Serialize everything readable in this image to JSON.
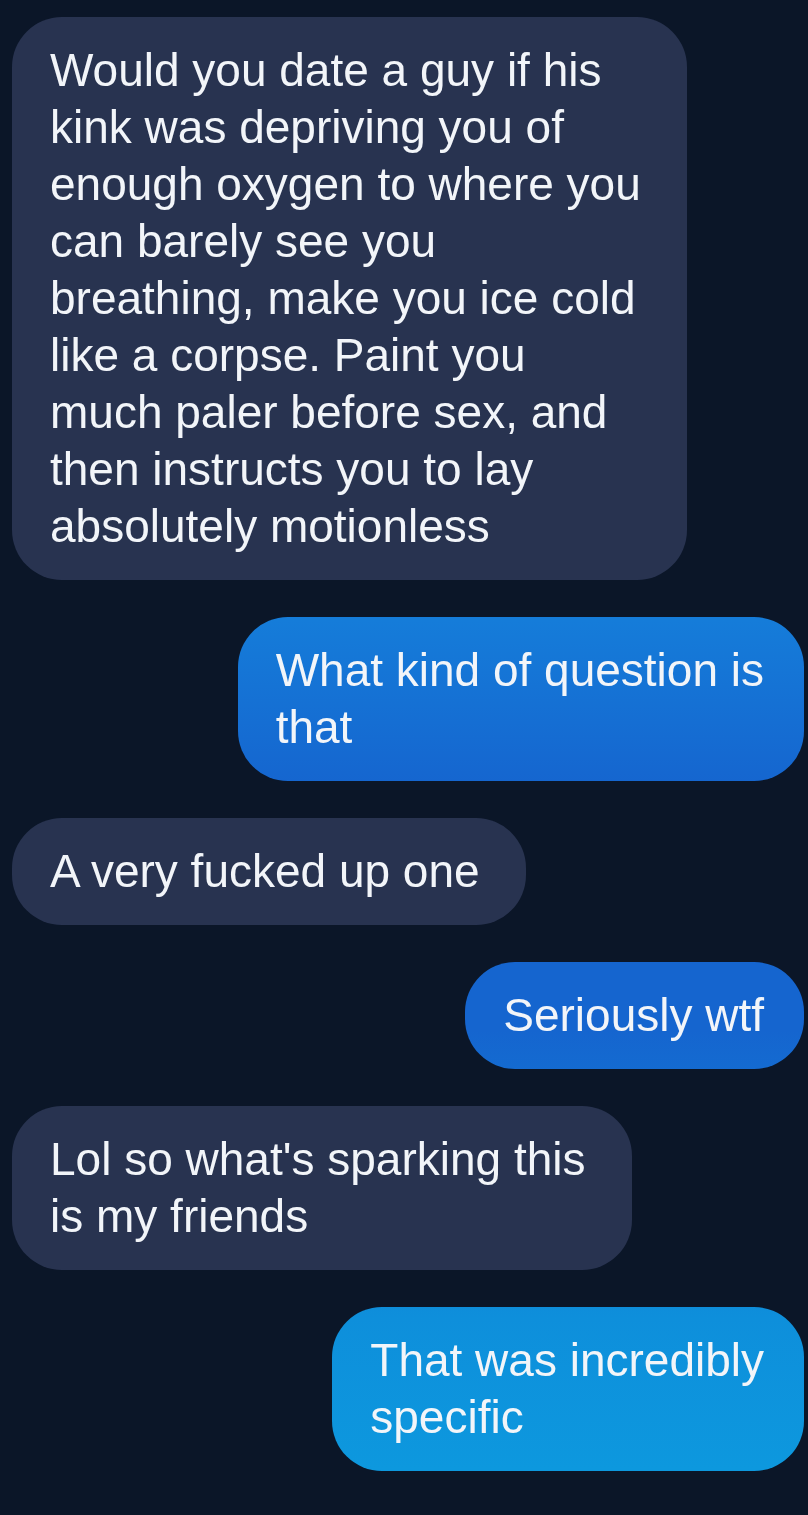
{
  "messages": [
    {
      "kind": "received",
      "lines": [
        "Would you date a guy if his",
        "kink was depriving you of",
        "enough oxygen to where you",
        "can barely see you",
        "breathing, make you ice cold",
        "like a corpse. Paint you",
        "much paler before sex, and",
        "then instructs you to lay",
        "absolutely motionless"
      ]
    },
    {
      "kind": "sent",
      "lines": [
        "What kind of question is",
        "that"
      ]
    },
    {
      "kind": "received",
      "lines": [
        "A very fucked up one"
      ]
    },
    {
      "kind": "sent",
      "lines": [
        "Seriously wtf"
      ]
    },
    {
      "kind": "received",
      "lines": [
        "Lol so what's sparking this",
        "is my friends"
      ]
    },
    {
      "kind": "sent",
      "lines": [
        "That was incredibly",
        "specific"
      ]
    }
  ]
}
